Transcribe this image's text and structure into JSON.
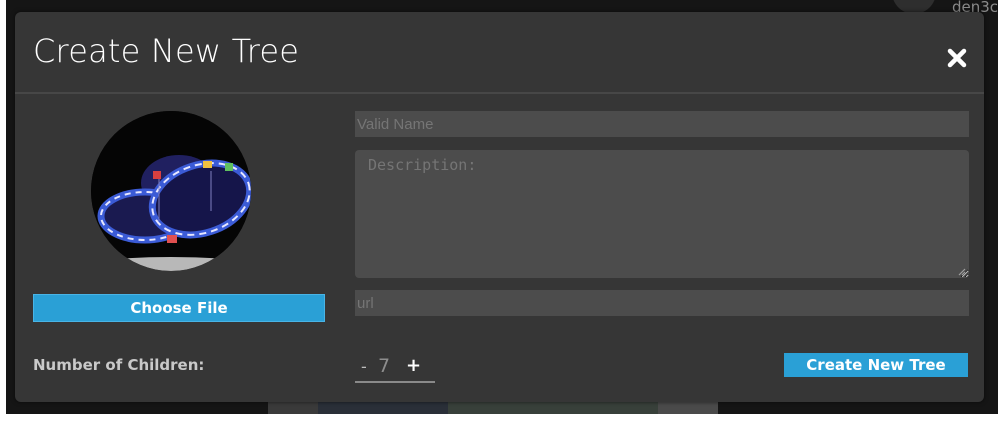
{
  "background": {
    "username": "den3c"
  },
  "modal": {
    "title": "Create New Tree",
    "close_icon": "close-icon"
  },
  "form": {
    "choose_file_label": "Choose File",
    "name_placeholder": "Valid Name",
    "name_value": "",
    "description_placeholder": "Description:",
    "description_value": "",
    "url_placeholder": "url",
    "url_value": "",
    "children_label": "Number of Children:",
    "children_minus": "-",
    "children_value": "7",
    "children_plus": "+",
    "submit_label": "Create New Tree"
  },
  "colors": {
    "accent": "#2aa0d6",
    "modal_bg": "#363636",
    "field_bg": "#4c4c4c"
  }
}
